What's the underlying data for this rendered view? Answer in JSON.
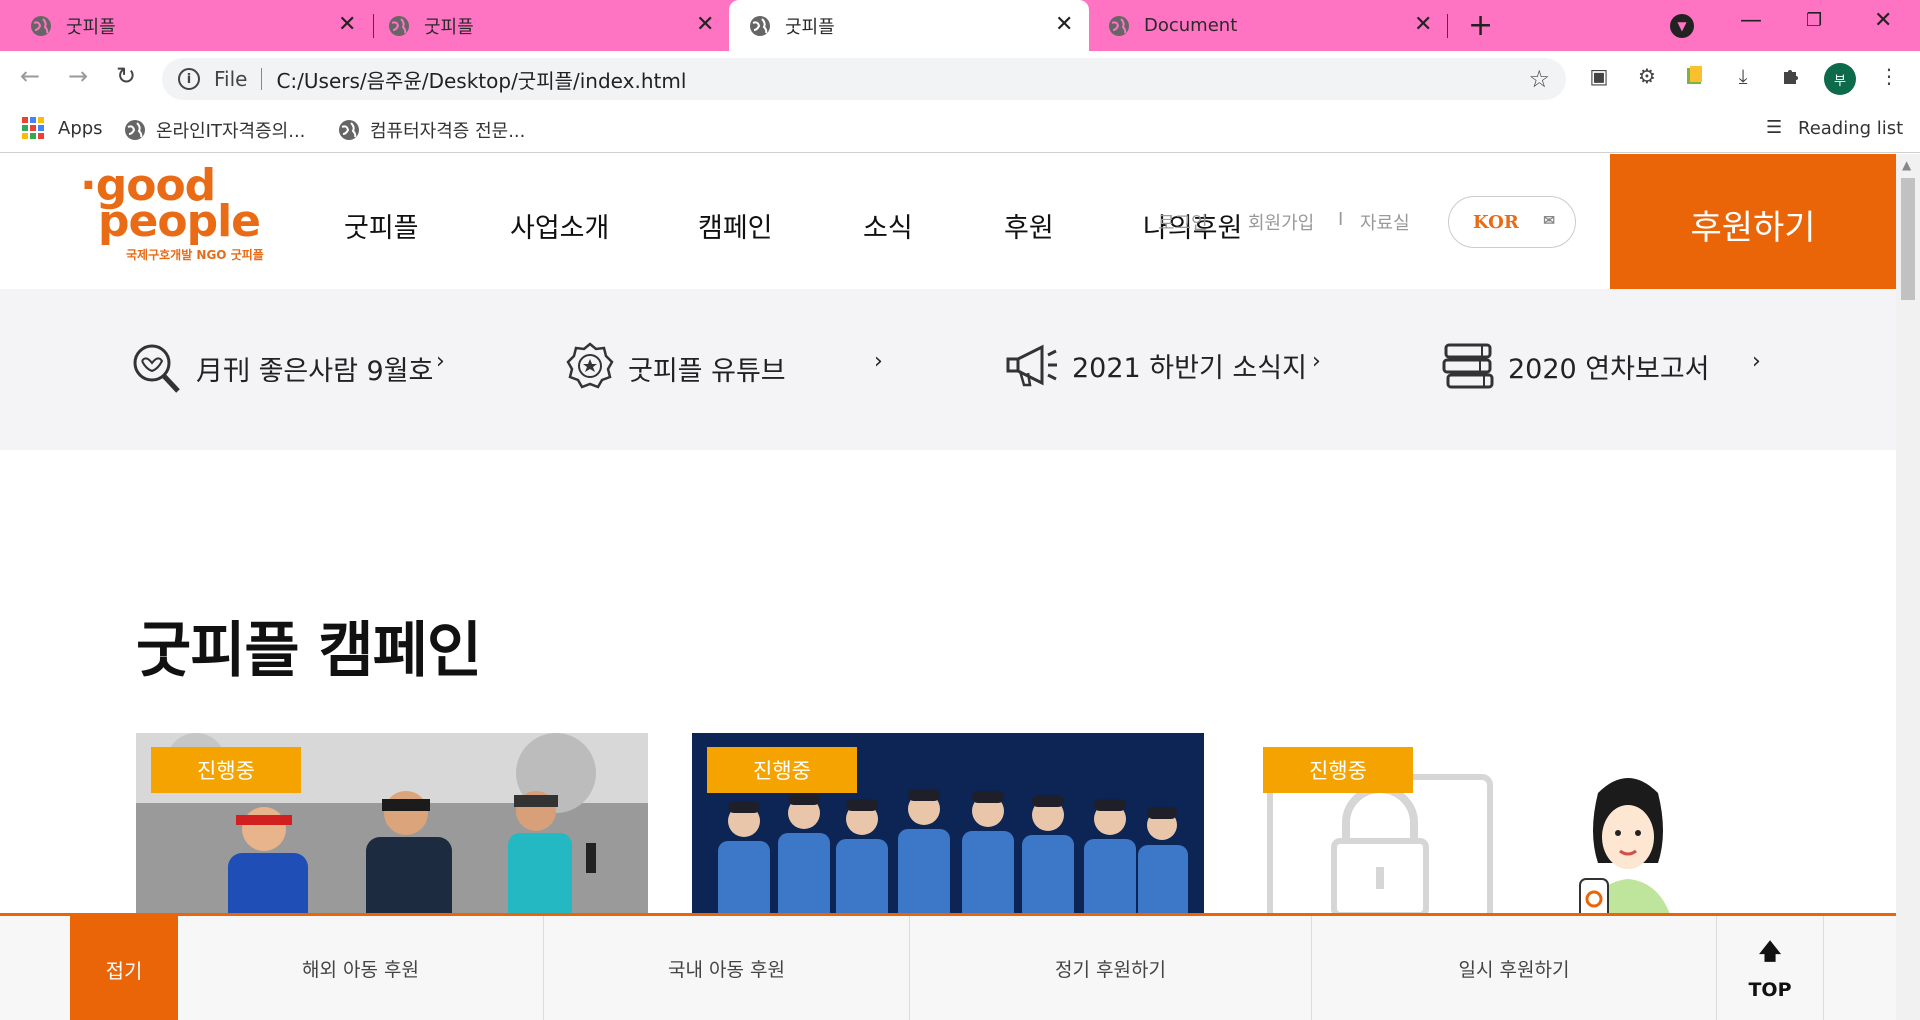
{
  "browser": {
    "tabs": [
      {
        "title": "굿피플",
        "active": false
      },
      {
        "title": "굿피플",
        "active": false
      },
      {
        "title": "굿피플",
        "active": true
      },
      {
        "title": "Document",
        "active": false
      }
    ],
    "address": {
      "scheme": "File",
      "url": "C:/Users/음주윤/Desktop/굿피플/index.html"
    },
    "profile_initial": "부",
    "bookmarks": {
      "apps": "Apps",
      "items": [
        "온라인IT자격증의...",
        "컴퓨터자격증 전문..."
      ],
      "reading_list": "Reading list"
    },
    "tabbar_color": "#ff73c3"
  },
  "site": {
    "logo": {
      "line1": "·good",
      "line2": "people",
      "tagline": "국제구호개발 NGO 굿피플"
    },
    "gnb": [
      "굿피플",
      "사업소개",
      "캠페인",
      "소식",
      "후원",
      "나의후원"
    ],
    "util": {
      "login": "로그인",
      "join": "회원가입",
      "separator": "I",
      "archive": "자료실"
    },
    "lang": "KOR",
    "donate": "후원하기",
    "quick_links": [
      {
        "label": "月刊 좋은사람 9월호",
        "icon": "magnifier-heart-icon"
      },
      {
        "label": "굿피플 유튜브",
        "icon": "award-badge-icon"
      },
      {
        "label": "2021 하반기 소식지",
        "icon": "megaphone-icon"
      },
      {
        "label": "2020 연차보고서",
        "icon": "books-icon"
      }
    ],
    "campaign_title": "굿피플 캠페인",
    "campaigns": [
      {
        "badge": "진행중",
        "image": "runners-photo"
      },
      {
        "badge": "진행중",
        "image": "group-in-denim-photo"
      },
      {
        "badge": "진행중",
        "image": "locked-screen-illustration"
      }
    ],
    "bottom_bar": {
      "fold": "접기",
      "items": [
        "해외 아동 후원",
        "국내 아동 후원",
        "정기 후원하기",
        "일시 후원하기"
      ],
      "top": "TOP"
    },
    "accent_color": "#ea6408",
    "badge_color": "#f5a300"
  }
}
